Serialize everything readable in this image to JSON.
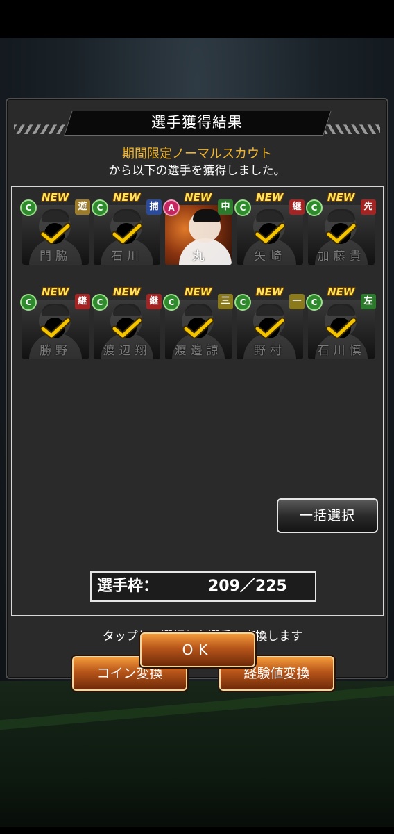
{
  "dialog": {
    "title": "選手獲得結果",
    "message_highlight": "期間限定ノーマルスカウト",
    "message": "から以下の選手を獲得しました。",
    "new_label": "NEW",
    "cards": [
      {
        "name": "門脇",
        "rank": "C",
        "position": "遊",
        "checked": true
      },
      {
        "name": "石川",
        "rank": "C",
        "position": "捕",
        "checked": true
      },
      {
        "name": "丸",
        "rank": "A",
        "position": "中",
        "checked": false
      },
      {
        "name": "矢崎",
        "rank": "C",
        "position": "継",
        "checked": true
      },
      {
        "name": "加藤貴",
        "rank": "C",
        "position": "先",
        "checked": true
      },
      {
        "name": "勝野",
        "rank": "C",
        "position": "継",
        "checked": true
      },
      {
        "name": "渡辺翔",
        "rank": "C",
        "position": "継",
        "checked": true
      },
      {
        "name": "渡邉諒",
        "rank": "C",
        "position": "三",
        "checked": true
      },
      {
        "name": "野村",
        "rank": "C",
        "position": "一",
        "checked": true
      },
      {
        "name": "石川慎",
        "rank": "C",
        "position": "左",
        "checked": true
      }
    ],
    "bulk_select_label": "一括選択",
    "slot_label": "選手枠：",
    "slot_value": "209／225",
    "instruction": "タップして選択した選手を変換します",
    "coin_convert_label": "コイン変換",
    "exp_convert_label": "経験値変換",
    "ok_label": "OK"
  },
  "colors": {
    "highlight": "#f0b52b",
    "rank_c": "#2f8a2d",
    "rank_a": "#c42760",
    "check": "#f5c400"
  }
}
